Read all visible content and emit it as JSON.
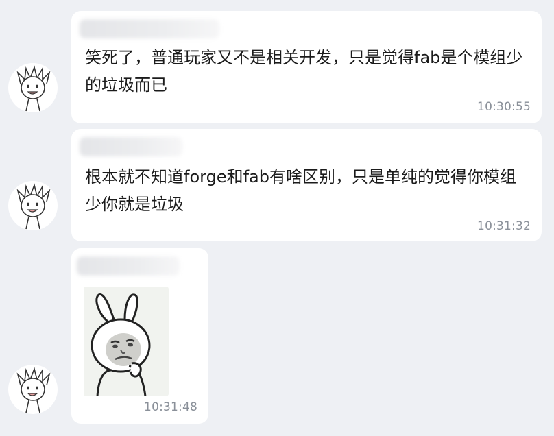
{
  "messages": [
    {
      "sender": "用户",
      "text": "笑死了，普通玩家又不是相关开发，只是觉得fab是个模组少的垃圾而已",
      "time": "10:30:55",
      "avatar_icon": "cartoon-boy-icon"
    },
    {
      "sender": "用户",
      "text": "根本就不知道forge和fab有啥区别，只是单纯的觉得你模组少你就是垃圾",
      "time": "10:31:32",
      "avatar_icon": "cartoon-boy-icon"
    },
    {
      "sender": "用户",
      "sticker_icon": "bunny-meme-sticker-icon",
      "time": "10:31:48",
      "avatar_icon": "cartoon-boy-icon"
    }
  ],
  "colors": {
    "background": "#eef0f4",
    "bubble": "#ffffff",
    "text": "#1b1b1b",
    "timestamp": "#8a9099"
  }
}
